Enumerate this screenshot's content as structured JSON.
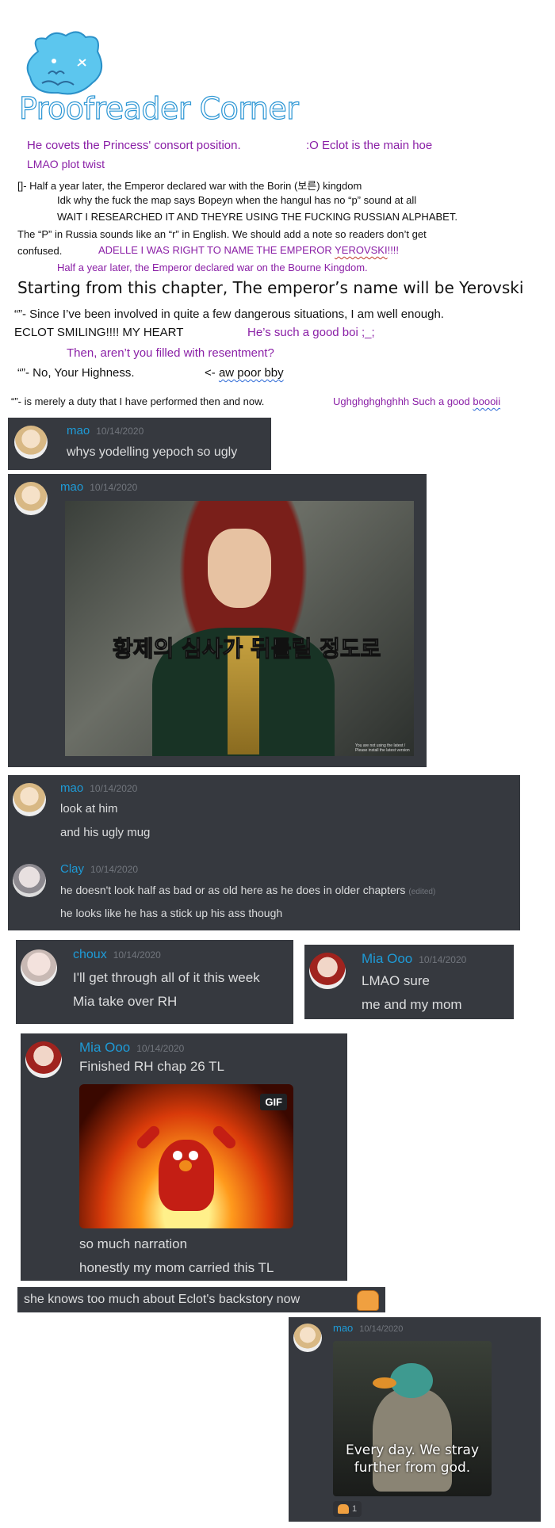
{
  "header": {
    "logo_text": "Proofreader Corner"
  },
  "notes": {
    "l1a": "He covets the Princess' consort position.",
    "l1b": ":O Eclot is the main hoe",
    "l2": "LMAO plot twist",
    "l3": "[]- Half a year later, the Emperor declared war with the Borin (보른) kingdom",
    "l4": "Idk why the fuck the map says Bopeyn when the hangul has no “p” sound at all",
    "l5": "WAIT I RESEARCHED IT AND THEYRE USING THE FUCKING RUSSIAN ALPHABET.",
    "l6": "The “P” in Russia sounds like  an “r” in English. We should add a note so readers don’t get",
    "l7a": "confused.",
    "l7b": "ADELLE I WAS RIGHT TO NAME THE EMPEROR ",
    "l7c": "YEROVSKI",
    "l7d": "!!!!",
    "l8": "Half a year later, the Emperor declared war on the Bourne Kingdom.",
    "l9": "Starting from this chapter, The emperor’s name will be Yerovski",
    "l10": "“”- Since I’ve been involved in quite a few dangerous situations, I am well enough.",
    "l11a": "ECLOT SMILING!!!! MY HEART",
    "l11b": "He’s such a good boi ;_;",
    "l12": "Then, aren’t you filled with resentment?",
    "l13a": "“”- No, Your Highness.",
    "l13b": "<- ",
    "l13c": "aw poor bby",
    "l14a": "“”- is merely a duty that I have performed then and now.",
    "l14b": "Ughghghghghhh Such a good ",
    "l14c": "boooii"
  },
  "chat1": {
    "user": "mao",
    "time": "10/14/2020",
    "text": "whys yodelling yepoch so ugly"
  },
  "chat2": {
    "user": "mao",
    "time": "10/14/2020",
    "image_caption": "황제의 심사가 뒤틀릴 정도로",
    "corner_note": "You are not using the latest / Please install the latest version"
  },
  "chat3": {
    "m1_user": "mao",
    "m1_time": "10/14/2020",
    "m1_text1": "look at him",
    "m1_text2": "and his ugly mug",
    "m2_user": "Clay",
    "m2_time": "10/14/2020",
    "m2_text1": "he doesn't look half as bad or as old here as he does in older chapters",
    "m2_edited": "(edited)",
    "m2_text2": "he looks like he has a stick up his ass though"
  },
  "chat4": {
    "user": "choux",
    "time": "10/14/2020",
    "text1": "I'll get through all of it this week",
    "text2": "Mia take over RH"
  },
  "chat5": {
    "user": "Mia Ooo",
    "time": "10/14/2020",
    "text1": "LMAO sure",
    "text2": "me and my mom"
  },
  "chat6": {
    "user": "Mia Ooo",
    "time": "10/14/2020",
    "text1": "Finished RH chap 26 TL",
    "gif_badge": "GIF",
    "text2": "so much narration",
    "text3": "honestly my mom carried this TL"
  },
  "chat7": {
    "text": "she knows too much about Eclot's backstory now"
  },
  "chat8": {
    "user": "mao",
    "time": "10/14/2020",
    "meme_text1": "Every day. We stray",
    "meme_text2": "further from god.",
    "reaction_count": "1"
  }
}
